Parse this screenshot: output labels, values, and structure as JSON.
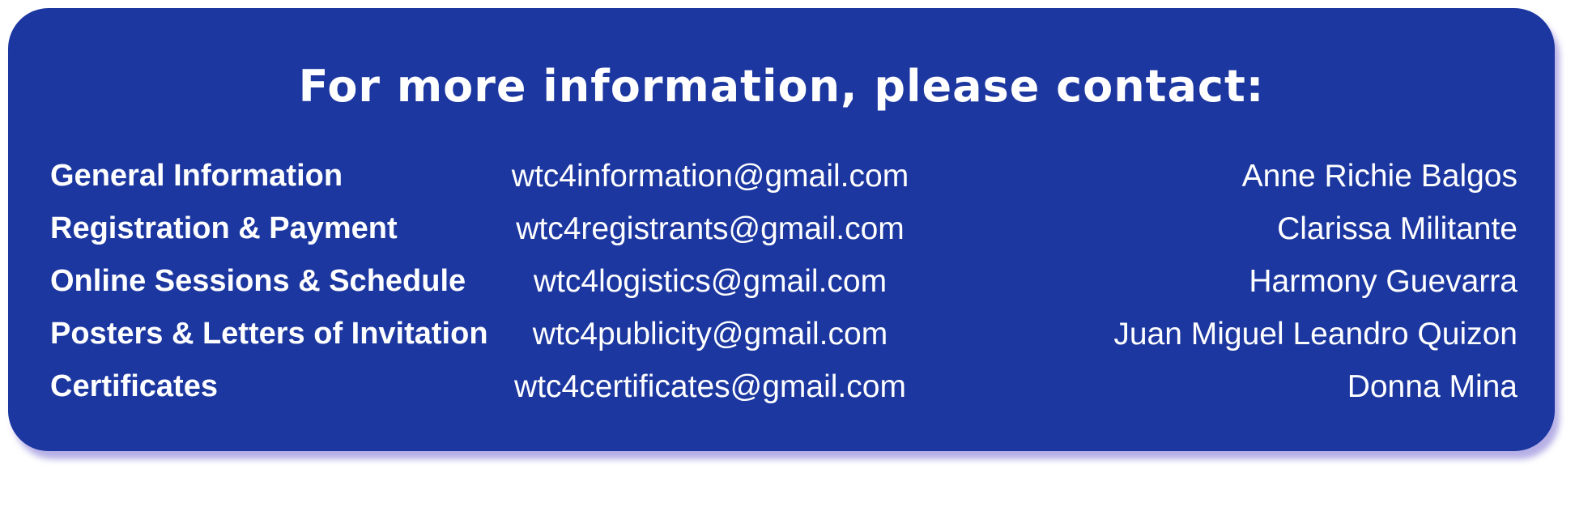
{
  "heading": "For more information, please contact:",
  "colors": {
    "card_background": "#1c37a0",
    "text": "#ffffff",
    "shadow": "#786ed2"
  },
  "contacts": [
    {
      "topic": "General Information",
      "email": "wtc4information@gmail.com",
      "person": "Anne Richie Balgos"
    },
    {
      "topic": "Registration & Payment",
      "email": "wtc4registrants@gmail.com",
      "person": "Clarissa Militante"
    },
    {
      "topic": "Online Sessions & Schedule",
      "email": "wtc4logistics@gmail.com",
      "person": "Harmony Guevarra"
    },
    {
      "topic": "Posters & Letters of Invitation",
      "email": "wtc4publicity@gmail.com",
      "person": "Juan Miguel Leandro Quizon"
    },
    {
      "topic": "Certificates",
      "email": "wtc4certificates@gmail.com",
      "person": "Donna Mina"
    }
  ]
}
